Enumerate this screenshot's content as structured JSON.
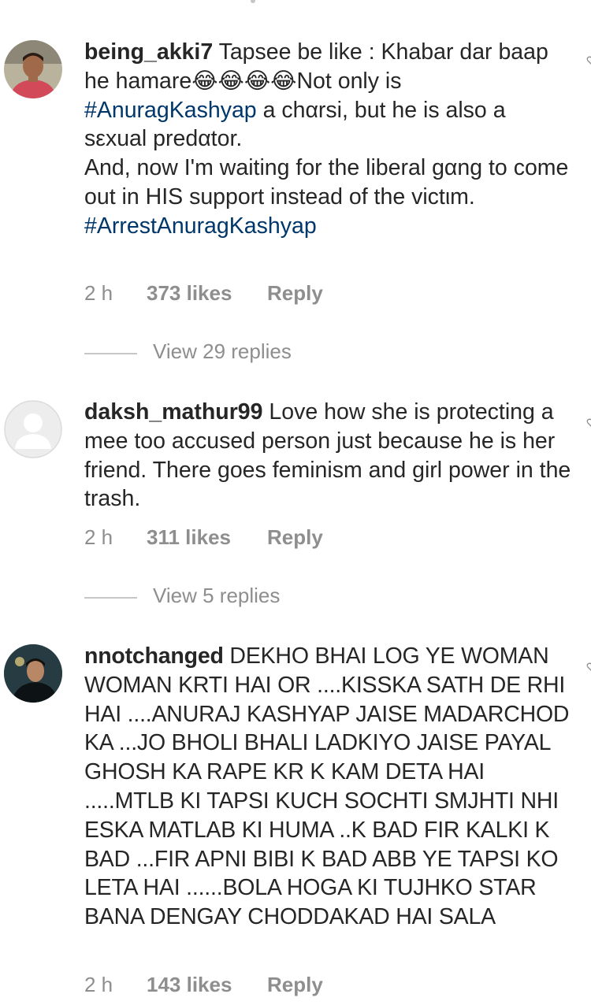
{
  "comments": [
    {
      "username": "being_akki7",
      "text_parts": [
        {
          "t": " Tapsee be like : Khabar dar baap he hamare😂😂😂😂Not only is ",
          "tag": false
        },
        {
          "t": "#AnuragKashyap",
          "tag": true
        },
        {
          "t": " a chαrsi, but he is also a sεxual predαtor.\nAnd, now I'm waiting for the liberal gαng to come out in HIS support instead of the victιm.\n",
          "tag": false
        },
        {
          "t": "#ArrestAnuragKashyap",
          "tag": true
        }
      ],
      "time": "2 h",
      "likes": "373 likes",
      "reply": "Reply",
      "view_replies": "View 29 replies"
    },
    {
      "username": "daksh_mathur99",
      "text_parts": [
        {
          "t": " Love how she is protecting a mee too accused person just because he is her friend. There goes feminism and girl power in the trash.",
          "tag": false
        }
      ],
      "time": "2 h",
      "likes": "311 likes",
      "reply": "Reply",
      "view_replies": "View 5 replies"
    },
    {
      "username": "nnotchanged",
      "text_parts": [
        {
          "t": " DEKHO BHAI LOG YE WOMAN WOMAN KRTI HAI OR ....KISSKA SATH DE RHI HAI ....ANURAJ KASHYAP JAISE MADARCHOD KA ...JO BHOLI BHALI LADKIYO JAISE PAYAL GHOSH KA RAPE KR  K KAM DETA HAI .....MTLB KI TAPSI KUCH SOCHTI SMJHTI NHI ESKA MATLAB KI HUMA ..K BAD FIR KALKI K BAD ...FIR APNI BIBI K BAD ABB YE TAPSI KO LETA HAI ......BOLA HOGA KI TUJHKO STAR BANA DENGAY CHODDAKAD HAI SALA",
          "tag": false
        }
      ],
      "time": "2 h",
      "likes": "143 likes",
      "reply": "Reply"
    }
  ],
  "icons": {
    "avatar_1": "user-photo-red-shirt",
    "avatar_2": "default-avatar-placeholder",
    "avatar_3": "user-photo-dark",
    "like": "heart-outline-icon"
  },
  "colors": {
    "text": "#262626",
    "muted": "#8e8e8e",
    "hashtag": "#00376b"
  }
}
